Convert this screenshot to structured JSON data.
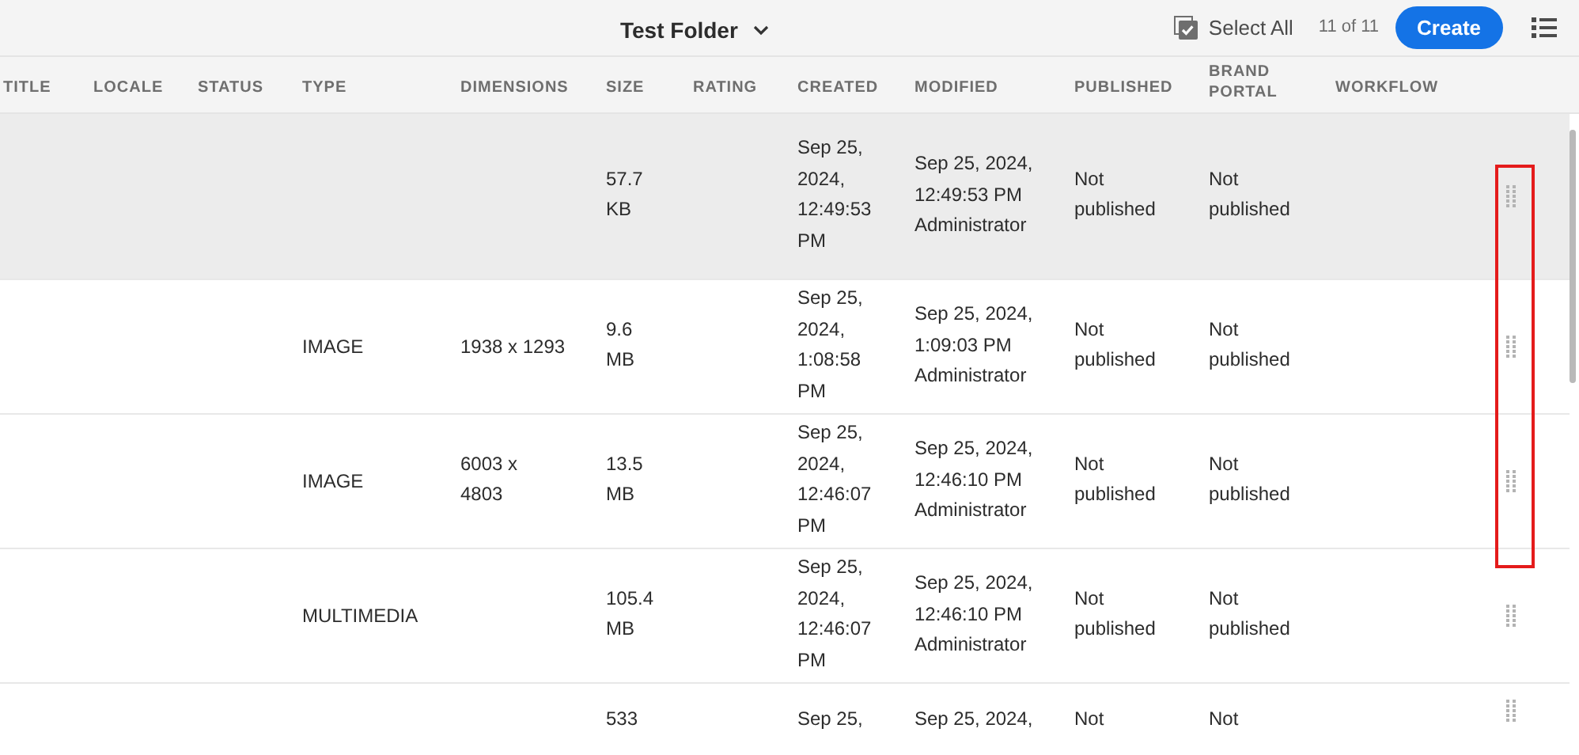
{
  "header": {
    "title": "Test Folder",
    "select_all": "Select All",
    "count": "11 of 11",
    "create": "Create"
  },
  "columns": [
    "TITLE",
    "LOCALE",
    "STATUS",
    "TYPE",
    "DIMENSIONS",
    "SIZE",
    "RATING",
    "CREATED",
    "MODIFIED",
    "PUBLISHED",
    "BRAND PORTAL",
    "WORKFLOW"
  ],
  "rows": [
    {
      "selected": true,
      "size": "57.7\nKB",
      "created": "Sep 25,\n2024,\n12:49:53\nPM",
      "modified": "Sep 25, 2024,\n12:49:53 PM\nAdministrator",
      "published": "Not\npublished",
      "brand_portal": "Not\npublished"
    },
    {
      "selected": false,
      "type": "IMAGE",
      "dimensions": "1938 x 1293",
      "size": "9.6\nMB",
      "created": "Sep 25,\n2024,\n1:08:58\nPM",
      "modified": "Sep 25, 2024,\n1:09:03 PM\nAdministrator",
      "published": "Not\npublished",
      "brand_portal": "Not\npublished"
    },
    {
      "selected": false,
      "type": "IMAGE",
      "dimensions": "6003 x\n4803",
      "size": "13.5\nMB",
      "created": "Sep 25,\n2024,\n12:46:07\nPM",
      "modified": "Sep 25, 2024,\n12:46:10 PM\nAdministrator",
      "published": "Not\npublished",
      "brand_portal": "Not\npublished"
    },
    {
      "selected": false,
      "type": "MULTIMEDIA",
      "size": "105.4\nMB",
      "created": "Sep 25,\n2024,\n12:46:07\nPM",
      "modified": "Sep 25, 2024,\n12:46:10 PM\nAdministrator",
      "published": "Not\npublished",
      "brand_portal": "Not\npublished"
    },
    {
      "selected": false,
      "size": "533",
      "created": "Sep 25,",
      "modified": "Sep 25, 2024,",
      "published": "Not",
      "brand_portal": "Not"
    }
  ]
}
